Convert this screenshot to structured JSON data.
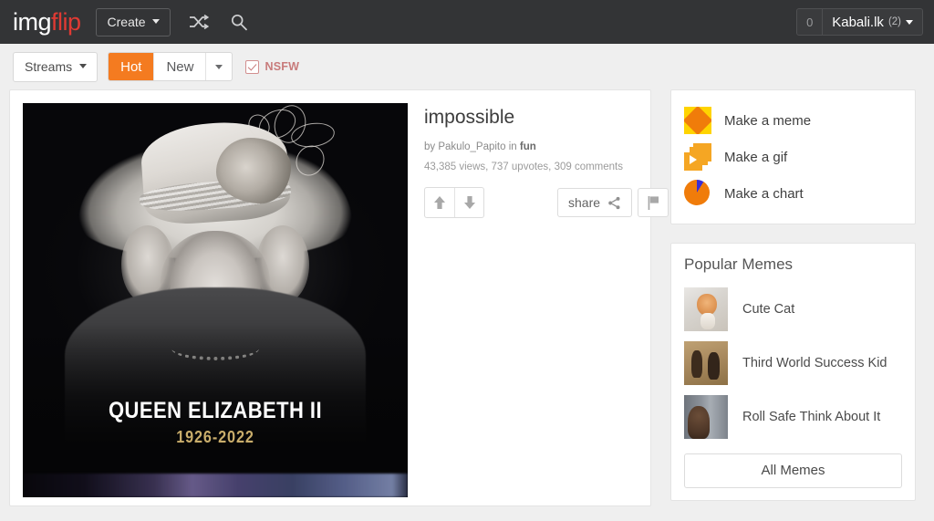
{
  "navbar": {
    "logo_img": "img",
    "logo_flip": "flip",
    "create_label": "Create",
    "shuffle_icon": "shuffle-icon",
    "search_icon": "search-icon",
    "notification_count": "0",
    "username": "Kabali.lk",
    "user_badge": "(2)"
  },
  "filterbar": {
    "streams_label": "Streams",
    "hot_label": "Hot",
    "new_label": "New",
    "nsfw_label": "NSFW",
    "nsfw_checked": true,
    "active_sort": "Hot"
  },
  "post": {
    "title": "impossible",
    "by_prefix": "by",
    "author": "Pakulo_Papito",
    "in_word": "in",
    "stream": "fun",
    "stats": "43,385 views, 737 upvotes, 309 comments",
    "views": "43,385",
    "upvotes": "737",
    "comments": "309",
    "share_label": "share",
    "upvote_icon": "arrow-up-icon",
    "downvote_icon": "arrow-down-icon",
    "share_icon": "share-icon",
    "flag_icon": "flag-icon",
    "image": {
      "alt": "Black and white portrait of Queen Elizabeth II wearing a wide-brimmed hat",
      "caption_line1": "QUEEN ELIZABETH II",
      "caption_line2": "1926-2022",
      "caption_line1_color": "#ffffff",
      "caption_line2_color": "#c9ad6b"
    }
  },
  "sidebar": {
    "make_items": [
      {
        "label": "Make a meme",
        "icon": "pinwheel-icon"
      },
      {
        "label": "Make a gif",
        "icon": "gif-frames-icon"
      },
      {
        "label": "Make a chart",
        "icon": "pie-chart-icon"
      }
    ],
    "popular_title": "Popular Memes",
    "memes": [
      {
        "name": "Cute Cat",
        "thumb": "cute-cat-thumbnail"
      },
      {
        "name": "Third World Success Kid",
        "thumb": "third-world-success-kid-thumbnail"
      },
      {
        "name": "Roll Safe Think About It",
        "thumb": "roll-safe-thumbnail"
      }
    ],
    "all_memes_label": "All Memes"
  },
  "colors": {
    "navbar_bg": "#333436",
    "accent_orange": "#f47b20",
    "logo_red": "#e03a33",
    "nsfw_red": "#c87b7b",
    "page_bg": "#efefef"
  }
}
